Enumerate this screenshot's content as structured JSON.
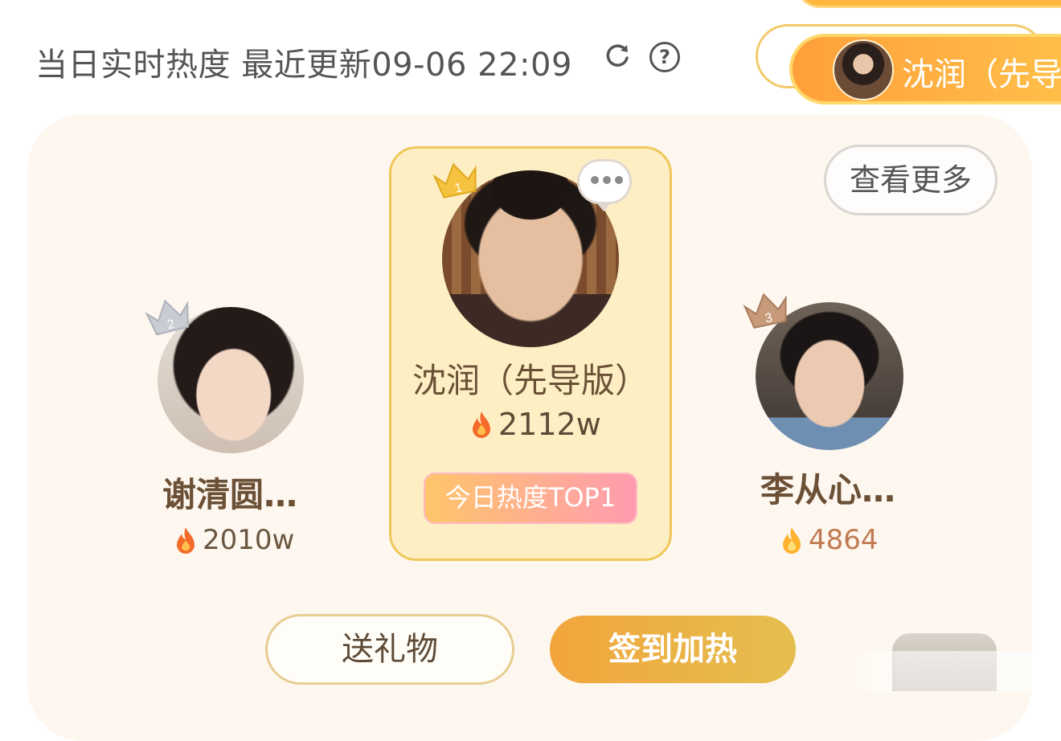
{
  "header": {
    "title": "当日实时热度 最近更新09-06 22:09",
    "help_label": "?"
  },
  "floating_badge": {
    "text": "沈润（先导"
  },
  "more_button": {
    "label": "查看更多"
  },
  "ranking": [
    {
      "rank": 1,
      "rank_label": "1",
      "name": "沈润（先导版）",
      "heat": "2112w",
      "badge": "今日热度TOP1"
    },
    {
      "rank": 2,
      "rank_label": "2",
      "name": "谢清圆…",
      "heat": "2010w"
    },
    {
      "rank": 3,
      "rank_label": "3",
      "name": "李从心…",
      "heat": "4864"
    }
  ],
  "actions": {
    "gift_label": "送礼物",
    "checkin_label": "签到加热"
  },
  "colors": {
    "accent_orange": "#f2a53c",
    "gold_border": "#f0c85a",
    "card_bg": "#fdf7ef",
    "top1_bg": "#fdeec3",
    "rank3_heat": "#c27a52"
  },
  "icons": [
    "refresh-icon",
    "help-icon",
    "crown-icon",
    "flame-icon",
    "chat-bubble-icon"
  ]
}
